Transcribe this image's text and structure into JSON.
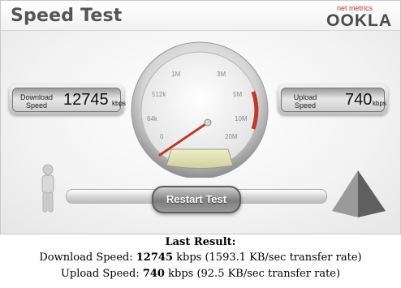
{
  "header": {
    "title": "Speed Test",
    "brand_tagline": "net metrics",
    "brand_name": "OOKLA"
  },
  "download_panel": {
    "label_line1": "Download",
    "label_line2": "Speed",
    "value": "12745",
    "unit": "kbps"
  },
  "upload_panel": {
    "label_line1": "Upload",
    "label_line2": "Speed",
    "value": "740",
    "unit": "kbps"
  },
  "gauge": {
    "ticks": [
      "0",
      "64k",
      "512k",
      "1M",
      "3M",
      "5M",
      "10M",
      "20M"
    ]
  },
  "controls": {
    "restart_label": "Restart Test"
  },
  "result": {
    "title": "Last Result:",
    "download_prefix": "Download Speed: ",
    "download_value": "12745",
    "download_suffix": " kbps (1593.1 KB/sec transfer rate)",
    "upload_prefix": "Upload Speed: ",
    "upload_value": "740",
    "upload_suffix": " kbps (92.5 KB/sec transfer rate)"
  },
  "colors": {
    "needle": "#c0392b",
    "accent": "#d0d0d0"
  }
}
